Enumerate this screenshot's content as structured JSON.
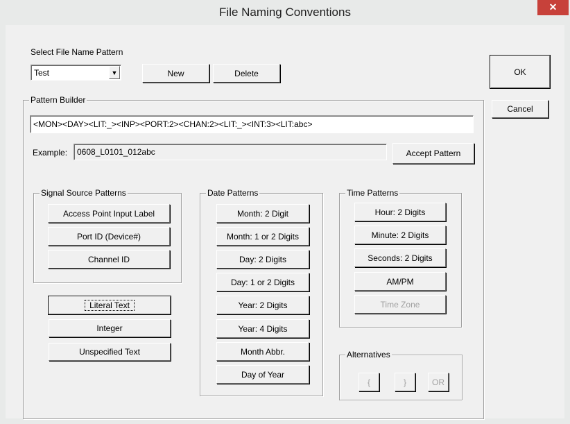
{
  "window": {
    "title": "File Naming Conventions",
    "close_glyph": "✕"
  },
  "select_pattern": {
    "label": "Select File Name Pattern",
    "value": "Test",
    "arrow": "▼"
  },
  "buttons": {
    "new": "New",
    "delete": "Delete",
    "ok": "OK",
    "cancel": "Cancel",
    "accept_pattern": "Accept Pattern"
  },
  "pattern_builder": {
    "title": "Pattern Builder",
    "pattern": "<MON><DAY><LIT:_><INP><PORT:2><CHAN:2><LIT:_><INT:3><LIT:abc>",
    "example_label": "Example:",
    "example_value": "0608_L0101_012abc"
  },
  "signal_source": {
    "title": "Signal Source Patterns",
    "items": [
      "Access Point Input Label",
      "Port ID (Device#)",
      "Channel ID"
    ]
  },
  "text_buttons": [
    "Literal Text",
    "Integer",
    "Unspecified Text"
  ],
  "date_patterns": {
    "title": "Date Patterns",
    "items": [
      "Month: 2 Digit",
      "Month: 1 or 2 Digits",
      "Day: 2 Digits",
      "Day: 1 or 2 Digits",
      "Year: 2 Digits",
      "Year: 4 Digits",
      "Month Abbr.",
      "Day of Year"
    ]
  },
  "time_patterns": {
    "title": "Time Patterns",
    "items": [
      "Hour: 2 Digits",
      "Minute: 2 Digits",
      "Seconds: 2 Digits",
      "AM/PM",
      "Time Zone"
    ]
  },
  "alternatives": {
    "title": "Alternatives",
    "items": [
      "{",
      "}",
      "OR"
    ]
  },
  "colors": {
    "close_button": "#c7413a",
    "dialog_bg": "#f0f0f0",
    "disabled_text": "#a0a0a0"
  }
}
